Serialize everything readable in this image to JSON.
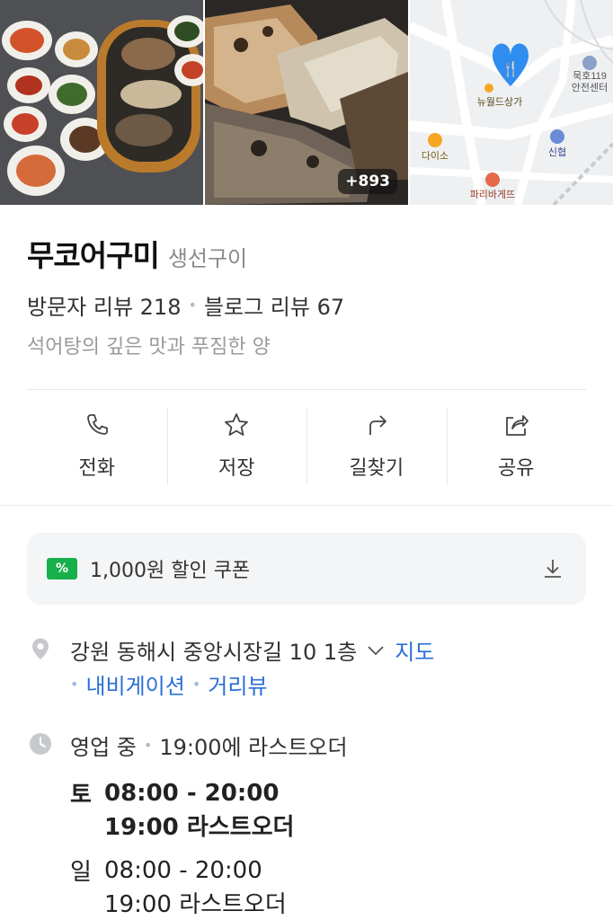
{
  "photos": {
    "more_count": "+893",
    "map_labels": {
      "restaurant": "뉴월드상가",
      "station": "묵호119\n안전센터",
      "store1": "다이소",
      "store2": "신협",
      "store3": "파리바게뜨"
    }
  },
  "place": {
    "name": "무코어구미",
    "category": "생선구이",
    "visitor_reviews": "방문자 리뷰 218",
    "blog_reviews": "블로그 리뷰 67",
    "tagline": "석어탕의 깊은 맛과 푸짐한 양"
  },
  "actions": [
    {
      "label": "전화",
      "icon": "phone-icon"
    },
    {
      "label": "저장",
      "icon": "star-icon"
    },
    {
      "label": "길찾기",
      "icon": "directions-icon"
    },
    {
      "label": "공유",
      "icon": "share-icon"
    }
  ],
  "coupon": {
    "badge": "%",
    "label": "1,000원 할인 쿠폰"
  },
  "address": {
    "text": "강원 동해시 중앙시장길 10 1층",
    "map_link": "지도",
    "navigation_link": "내비게이션",
    "street_view_link": "거리뷰"
  },
  "hours": {
    "status": "영업 중",
    "last_order_note": "19:00에 라스트오더",
    "days": [
      {
        "day": "토",
        "time": "08:00 - 20:00",
        "last_order": "19:00 라스트오더"
      },
      {
        "day": "일",
        "time": "08:00 - 20:00",
        "last_order": "19:00 라스트오더"
      }
    ]
  },
  "colors": {
    "link": "#2a6fd6",
    "coupon_badge": "#18b04a",
    "map_pin": "#2f8df0"
  }
}
